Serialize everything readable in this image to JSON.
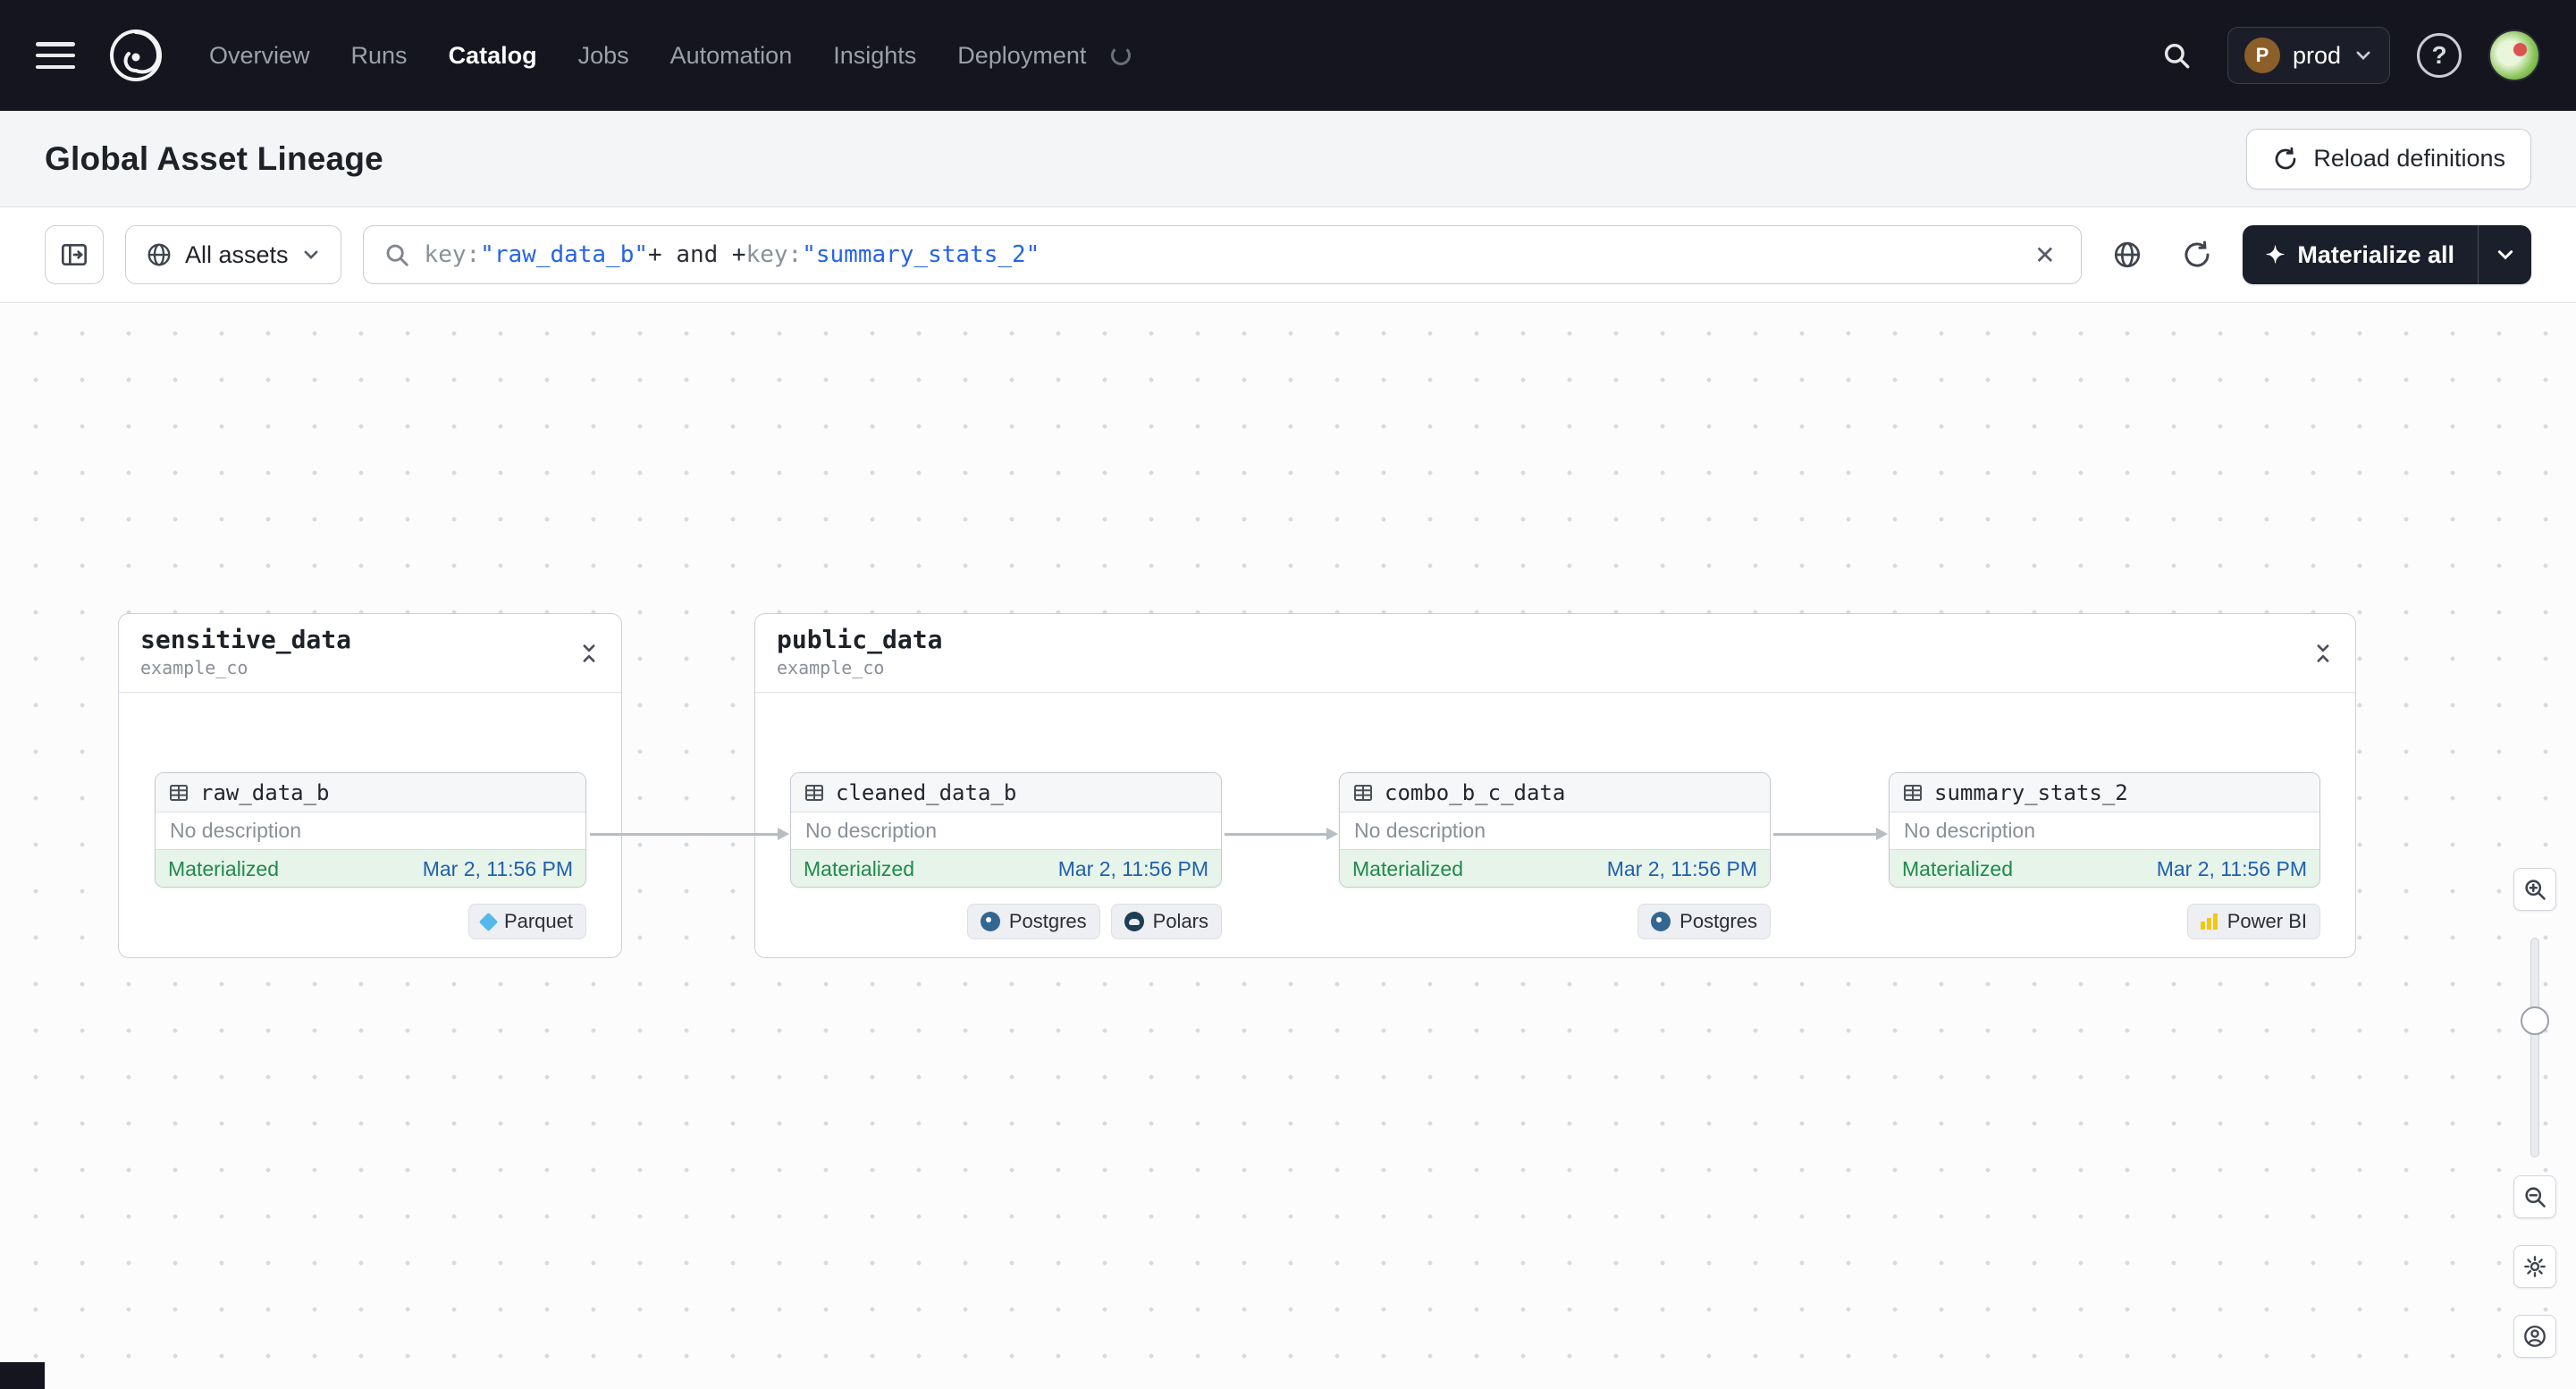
{
  "navbar": {
    "items": [
      {
        "label": "Overview"
      },
      {
        "label": "Runs"
      },
      {
        "label": "Catalog"
      },
      {
        "label": "Jobs"
      },
      {
        "label": "Automation"
      },
      {
        "label": "Insights"
      },
      {
        "label": "Deployment"
      }
    ],
    "env": {
      "initial": "P",
      "name": "prod"
    },
    "help": "?"
  },
  "header": {
    "title": "Global Asset Lineage",
    "reload_label": "Reload definitions"
  },
  "toolbar": {
    "filter_label": "All assets",
    "query": {
      "t1": "key:",
      "t2": "\"raw_data_b\"",
      "t3": "+ and +",
      "t4": "key:",
      "t5": "\"summary_stats_2\""
    },
    "clear": "✕",
    "materialize_icon": "✦",
    "materialize_label": "Materialize all"
  },
  "groups": [
    {
      "name": "sensitive_data",
      "org": "example_co"
    },
    {
      "name": "public_data",
      "org": "example_co"
    }
  ],
  "nodes": [
    {
      "name": "raw_data_b",
      "description": "No description",
      "status": "Materialized",
      "time": "Mar 2, 11:56 PM",
      "tags": [
        {
          "label": "Parquet"
        }
      ]
    },
    {
      "name": "cleaned_data_b",
      "description": "No description",
      "status": "Materialized",
      "time": "Mar 2, 11:56 PM",
      "tags": [
        {
          "label": "Postgres"
        },
        {
          "label": "Polars"
        }
      ]
    },
    {
      "name": "combo_b_c_data",
      "description": "No description",
      "status": "Materialized",
      "time": "Mar 2, 11:56 PM",
      "tags": [
        {
          "label": "Postgres"
        }
      ]
    },
    {
      "name": "summary_stats_2",
      "description": "No description",
      "status": "Materialized",
      "time": "Mar 2, 11:56 PM",
      "tags": [
        {
          "label": "Power BI"
        }
      ]
    }
  ],
  "colors": {
    "navbar_bg": "#14151E",
    "materialized_text": "#1F8A4C",
    "materialized_bg": "#E7F4EA",
    "query_string_blue": "#2563EB",
    "materialize_button_bg": "#1B1E2B"
  }
}
